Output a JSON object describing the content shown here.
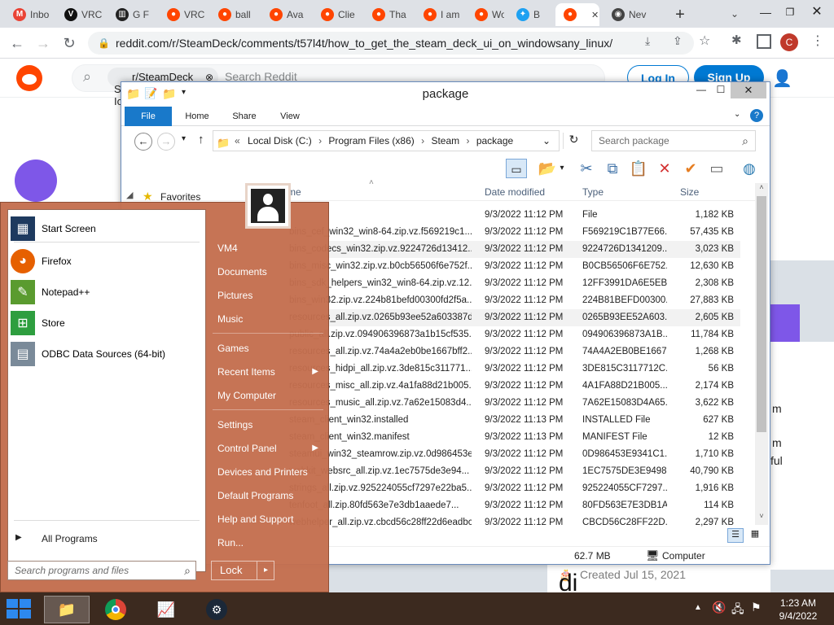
{
  "browser": {
    "tabs": [
      {
        "label": "Inbo",
        "icon": "gmail-icon"
      },
      {
        "label": "VRC",
        "icon": "vr-icon"
      },
      {
        "label": "G F",
        "icon": "bank-icon"
      },
      {
        "label": "VRC",
        "icon": "reddit-icon"
      },
      {
        "label": "ball",
        "icon": "reddit-icon"
      },
      {
        "label": "Ava",
        "icon": "reddit-icon"
      },
      {
        "label": "Clie",
        "icon": "reddit-icon"
      },
      {
        "label": "Tha",
        "icon": "reddit-icon"
      },
      {
        "label": "I am",
        "icon": "reddit-icon"
      },
      {
        "label": "Wo",
        "icon": "reddit-icon"
      },
      {
        "label": "B",
        "icon": "twitter-icon"
      },
      {
        "label": "",
        "icon": "reddit-icon"
      },
      {
        "label": "Nev",
        "icon": "chrome-icon"
      }
    ],
    "url": "reddit.com/r/SteamDeck/comments/t57l4t/how_to_get_the_steam_deck_ui_on_windowsany_linux/",
    "profile_initial": "C"
  },
  "reddit": {
    "community_chip": "r/SteamDeck",
    "search_placeholder": "Search Reddit",
    "login": "Log In",
    "signup": "Sign Up",
    "community_name": "r/Steam",
    "created": "Created Jul 15, 2021",
    "side_text_1": "m",
    "side_text_2": "m",
    "side_text_3": "ful",
    "partial_letters": "S\nIc",
    "logo_partial": "di"
  },
  "explorer": {
    "title": "package",
    "ribbon_tabs": [
      "File",
      "Home",
      "Share",
      "View"
    ],
    "breadcrumb": [
      "Local Disk (C:)",
      "Program Files (x86)",
      "Steam",
      "package"
    ],
    "search_placeholder": "Search package",
    "nav_favorites": "Favorites",
    "columns": {
      "name": "me",
      "date": "Date modified",
      "type": "Type",
      "size": "Size"
    },
    "files": [
      {
        "name": "",
        "date": "9/3/2022 11:12 PM",
        "type": "File",
        "size": "1,182 KB"
      },
      {
        "name": "bins_cef_win32_win8-64.zip.vz.f569219c1...",
        "date": "9/3/2022 11:12 PM",
        "type": "F569219C1B77E66...",
        "size": "57,435 KB"
      },
      {
        "name": "bins_codecs_win32.zip.vz.9224726d13412...",
        "date": "9/3/2022 11:12 PM",
        "type": "9224726D1341209...",
        "size": "3,023 KB"
      },
      {
        "name": "bins_misc_win32.zip.vz.b0cb56506f6e752f...",
        "date": "9/3/2022 11:12 PM",
        "type": "B0CB56506F6E752...",
        "size": "12,630 KB"
      },
      {
        "name": "bins_sdk_helpers_win32_win8-64.zip.vz.12...",
        "date": "9/3/2022 11:12 PM",
        "type": "12FF3991DA6E5EB...",
        "size": "2,308 KB"
      },
      {
        "name": "bins_win32.zip.vz.224b81befd00300fd2f5a...",
        "date": "9/3/2022 11:12 PM",
        "type": "224B81BEFD00300...",
        "size": "27,883 KB"
      },
      {
        "name": "resources_all.zip.vz.0265b93ee52a603387d...",
        "date": "9/3/2022 11:12 PM",
        "type": "0265B93EE52A603...",
        "size": "2,605 KB"
      },
      {
        "name": "public_all.zip.vz.094906396873a1b15cf535...",
        "date": "9/3/2022 11:12 PM",
        "type": "094906396873A1B...",
        "size": "11,784 KB"
      },
      {
        "name": "resources_all.zip.vz.74a4a2eb0be1667bff2...",
        "date": "9/3/2022 11:12 PM",
        "type": "74A4A2EB0BE1667...",
        "size": "1,268 KB"
      },
      {
        "name": "resources_hidpi_all.zip.vz.3de815c311771...",
        "date": "9/3/2022 11:12 PM",
        "type": "3DE815C3117712C...",
        "size": "56 KB"
      },
      {
        "name": "resources_misc_all.zip.vz.4a1fa88d21b005...",
        "date": "9/3/2022 11:12 PM",
        "type": "4A1FA88D21B005...",
        "size": "2,174 KB"
      },
      {
        "name": "resources_music_all.zip.vz.7a62e15083d4...",
        "date": "9/3/2022 11:12 PM",
        "type": "7A62E15083D4A65...",
        "size": "3,622 KB"
      },
      {
        "name": "steam_client_win32.installed",
        "date": "9/3/2022 11:13 PM",
        "type": "INSTALLED File",
        "size": "627 KB"
      },
      {
        "name": "steam_client_win32.manifest",
        "date": "9/3/2022 11:13 PM",
        "type": "MANIFEST File",
        "size": "12 KB"
      },
      {
        "name": "steamui_win32_steamrow.zip.vz.0d986453e...",
        "date": "9/3/2022 11:12 PM",
        "type": "0D986453E9341C1...",
        "size": "1,710 KB"
      },
      {
        "name": "webkit_websrc_all.zip.vz.1ec7575de3e94...",
        "date": "9/3/2022 11:12 PM",
        "type": "1EC7575DE3E9498...",
        "size": "40,790 KB"
      },
      {
        "name": "strings_all.zip.vz.925224055cf7297e22ba5...",
        "date": "9/3/2022 11:12 PM",
        "type": "925224055CF7297...",
        "size": "1,916 KB"
      },
      {
        "name": "tenfoot_all.zip.80fd563e7e3db1aaede7...",
        "date": "9/3/2022 11:12 PM",
        "type": "80FD563E7E3DB1A...",
        "size": "114 KB"
      },
      {
        "name": "webhelper_all.zip.vz.cbcd56c28ff22d6eadbc...",
        "date": "9/3/2022 11:12 PM",
        "type": "CBCD56C28FF22D...",
        "size": "2,297 KB"
      }
    ],
    "status_size": "62.7 MB",
    "status_location": "Computer"
  },
  "startmenu": {
    "pinned": [
      {
        "label": "Start Screen",
        "icon": "start-screen-icon"
      },
      {
        "label": "Firefox",
        "icon": "firefox-icon"
      },
      {
        "label": "Notepad++",
        "icon": "notepadpp-icon"
      },
      {
        "label": "Store",
        "icon": "store-icon"
      },
      {
        "label": "ODBC Data Sources (64-bit)",
        "icon": "odbc-icon"
      }
    ],
    "all_programs": "All Programs",
    "search_placeholder": "Search programs and files",
    "right_items": [
      {
        "label": "VM4",
        "arrow": false
      },
      {
        "label": "Documents",
        "arrow": false
      },
      {
        "label": "Pictures",
        "arrow": false
      },
      {
        "label": "Music",
        "arrow": false
      },
      {
        "label": "Games",
        "arrow": false
      },
      {
        "label": "Recent Items",
        "arrow": true
      },
      {
        "label": "My Computer",
        "arrow": false
      },
      {
        "label": "Settings",
        "arrow": false
      },
      {
        "label": "Control Panel",
        "arrow": true
      },
      {
        "label": "Devices and Printers",
        "arrow": false
      },
      {
        "label": "Default Programs",
        "arrow": false
      },
      {
        "label": "Help and Support",
        "arrow": false
      },
      {
        "label": "Run...",
        "arrow": false
      }
    ],
    "lock": "Lock",
    "shutdown_options": "▸"
  },
  "taskbar": {
    "time": "1:23 AM",
    "date": "9/4/2022"
  },
  "colors": {
    "reddit": "#ff4500",
    "reddit_blue": "#0079d3",
    "start_menu": "#c46e4e",
    "taskbar": "#3c2a1f"
  }
}
